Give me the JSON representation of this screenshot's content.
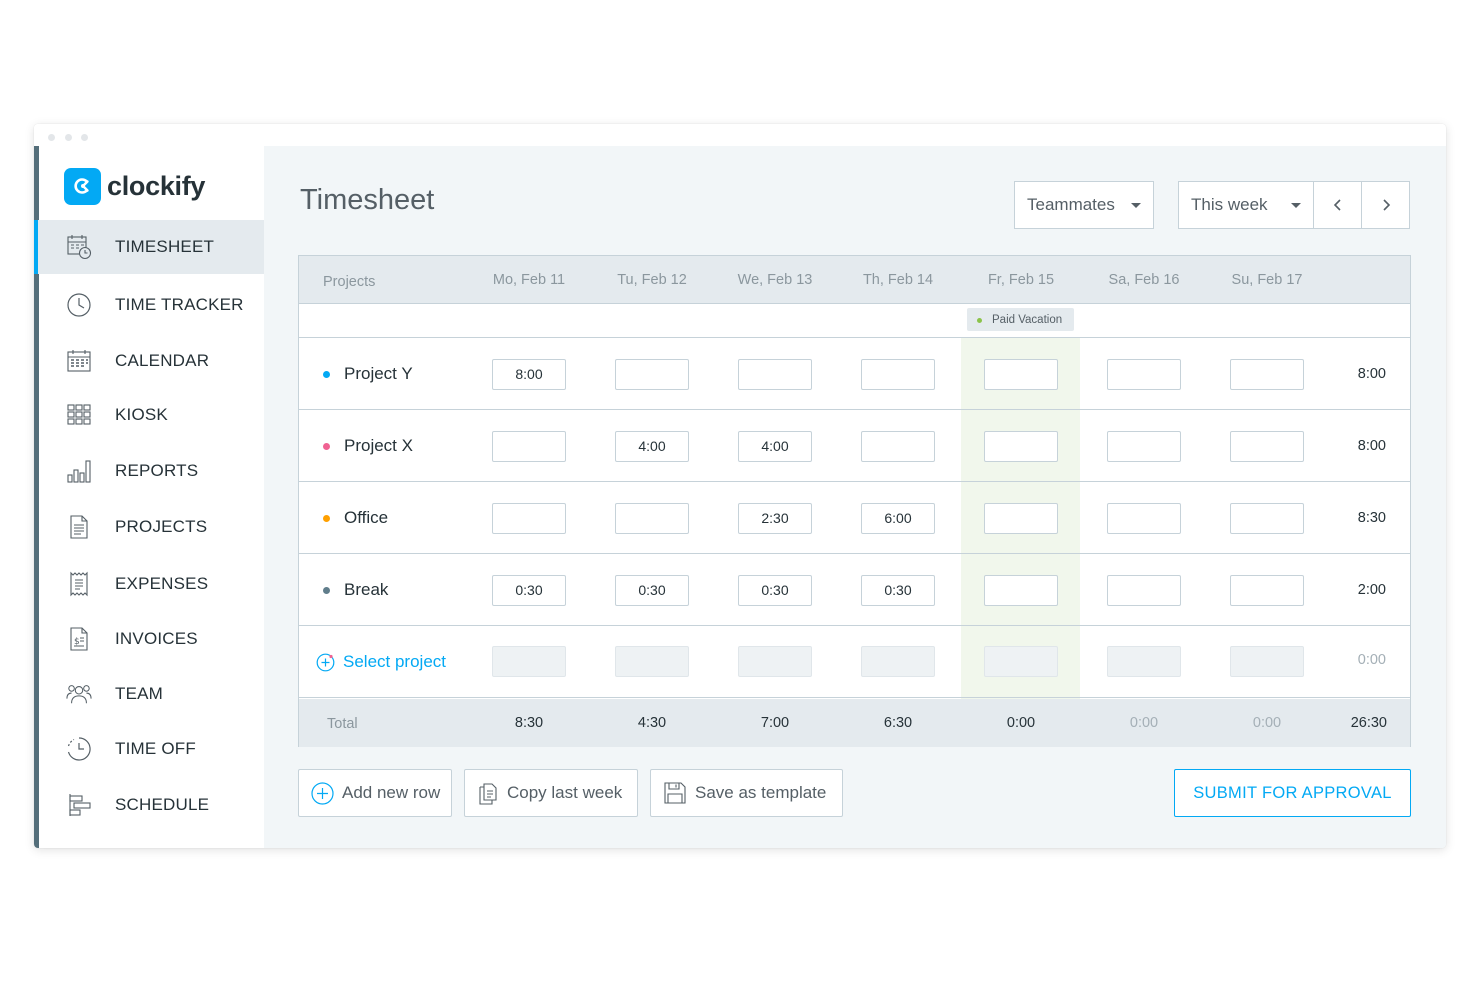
{
  "app": {
    "logo_text": "clockify",
    "brand_color": "#03a9f4"
  },
  "sidebar": {
    "items": [
      {
        "label": "TIMESHEET",
        "icon": "timesheet-icon",
        "active": true
      },
      {
        "label": "TIME TRACKER",
        "icon": "clock-icon",
        "active": false
      },
      {
        "label": "CALENDAR",
        "icon": "calendar-icon",
        "active": false
      },
      {
        "label": "KIOSK",
        "icon": "kiosk-grid-icon",
        "active": false
      },
      {
        "label": "REPORTS",
        "icon": "bar-chart-icon",
        "active": false
      },
      {
        "label": "PROJECTS",
        "icon": "document-icon",
        "active": false
      },
      {
        "label": "EXPENSES",
        "icon": "receipt-icon",
        "active": false
      },
      {
        "label": "INVOICES",
        "icon": "invoice-icon",
        "active": false
      },
      {
        "label": "TEAM",
        "icon": "team-icon",
        "active": false
      },
      {
        "label": "TIME OFF",
        "icon": "time-off-icon",
        "active": false
      },
      {
        "label": "SCHEDULE",
        "icon": "schedule-icon",
        "active": false
      }
    ]
  },
  "header": {
    "title": "Timesheet",
    "teammates_label": "Teammates",
    "range_label": "This week"
  },
  "table": {
    "projects_header": "Projects",
    "days": [
      "Mo, Feb 11",
      "Tu, Feb 12",
      "We, Feb 13",
      "Th, Feb 14",
      "Fr, Feb 15",
      "Sa, Feb 16",
      "Su, Feb 17"
    ],
    "vacation_label": "Paid Vacation",
    "rows": [
      {
        "name": "Project Y",
        "color": "#03a9f4",
        "cells": [
          "8:00",
          "",
          "",
          "",
          "",
          "",
          ""
        ],
        "total": "8:00"
      },
      {
        "name": "Project X",
        "color": "#f06292",
        "cells": [
          "",
          "4:00",
          "4:00",
          "",
          "",
          "",
          ""
        ],
        "total": "8:00"
      },
      {
        "name": "Office",
        "color": "#ffa000",
        "cells": [
          "",
          "",
          "2:30",
          "6:00",
          "",
          "",
          ""
        ],
        "total": "8:30"
      },
      {
        "name": "Break",
        "color": "#607d8b",
        "cells": [
          "0:30",
          "0:30",
          "0:30",
          "0:30",
          "",
          "",
          ""
        ],
        "total": "2:00"
      }
    ],
    "select_project_label": "Select project",
    "select_project_total": "0:00",
    "footer_label": "Total",
    "footer_totals": [
      "8:30",
      "4:30",
      "7:00",
      "6:30",
      "0:00",
      "0:00",
      "0:00"
    ],
    "grand_total": "26:30"
  },
  "actions": {
    "add_row": "Add new row",
    "copy_week": "Copy last week",
    "save_template": "Save as template",
    "submit": "SUBMIT FOR APPROVAL"
  }
}
